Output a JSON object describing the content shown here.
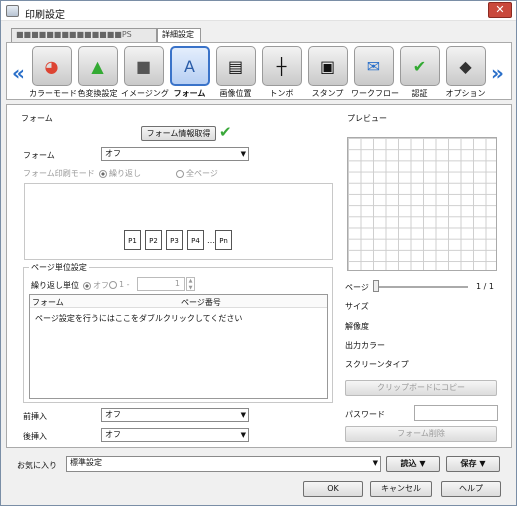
{
  "window": {
    "title": "印刷設定",
    "close": "✕"
  },
  "tabs": [
    "■■■■■■■■■■■■■■PS",
    "詳細設定"
  ],
  "ribbon": {
    "items": [
      {
        "label": "カラーモード",
        "icon": "color-mode-icon",
        "glyph": "◕"
      },
      {
        "label": "色変換設定",
        "icon": "color-convert-icon",
        "glyph": "▲"
      },
      {
        "label": "イメージング",
        "icon": "imaging-icon",
        "glyph": "■"
      },
      {
        "label": "フォーム",
        "icon": "form-icon",
        "glyph": "A"
      },
      {
        "label": "画像位置",
        "icon": "image-position-icon",
        "glyph": "▤"
      },
      {
        "label": "トンボ",
        "icon": "crop-marks-icon",
        "glyph": "┼"
      },
      {
        "label": "スタンプ",
        "icon": "stamp-icon",
        "glyph": "▣"
      },
      {
        "label": "ワークフロー",
        "icon": "workflow-icon",
        "glyph": "✉"
      },
      {
        "label": "認証",
        "icon": "authentication-icon",
        "glyph": "✔"
      },
      {
        "label": "オプション",
        "icon": "option-icon",
        "glyph": "◆"
      }
    ],
    "left": "«",
    "right": "»"
  },
  "form": {
    "group": "フォーム",
    "get_info": "フォーム情報取得",
    "check": "✔",
    "form_label": "フォーム",
    "form_value": "オフ",
    "mode_label": "フォーム印刷モード",
    "mode_repeat": "繰り返し",
    "mode_all": "全ページ",
    "pages": [
      "P1",
      "P2",
      "P3",
      "P4",
      "…",
      "Pn"
    ]
  },
  "page_unit": {
    "group": "ページ単位設定",
    "repeat_unit": "繰り返し単位",
    "off": "オフ",
    "one": "1 -",
    "count": "1",
    "col_form": "フォーム",
    "col_page": "ページ番号",
    "hint": "ページ設定を行うにはここをダブルクリックしてください"
  },
  "insert": {
    "front_label": "前挿入",
    "front_value": "オフ",
    "back_label": "後挿入",
    "back_value": "オフ"
  },
  "preview": {
    "group": "プレビュー",
    "page_label": "ページ",
    "page_value": "1 / 1",
    "size": "サイズ",
    "resolution": "解像度",
    "output_color": "出力カラー",
    "screen_type": "スクリーンタイプ",
    "copy_clipboard": "クリップボードにコピー",
    "password": "パスワード",
    "delete_form": "フォーム削除"
  },
  "favorites": {
    "label": "お気に入り",
    "value": "標準設定",
    "load": "読込",
    "save": "保存"
  },
  "footer": {
    "ok": "OK",
    "cancel": "キャンセル",
    "help": "ヘルプ"
  }
}
